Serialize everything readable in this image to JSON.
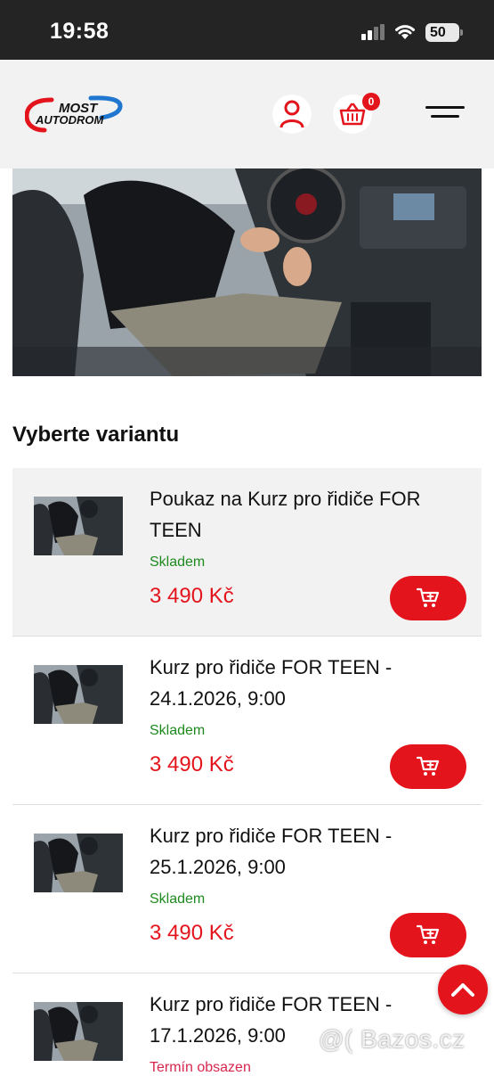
{
  "status_bar": {
    "time": "19:58",
    "battery": "50"
  },
  "header": {
    "logo_line1": "MOST",
    "logo_line2": "AUTODROM",
    "cart_count": "0"
  },
  "section_title": "Vyberte variantu",
  "variants": [
    {
      "title": "Poukaz na Kurz pro řidiče FOR TEEN",
      "stock": "Skladem",
      "price": "3 490 Kč"
    },
    {
      "title": "Kurz pro řidiče FOR TEEN - 24.1.2026, 9:00",
      "stock": "Skladem",
      "price": "3 490 Kč"
    },
    {
      "title": "Kurz pro řidiče FOR TEEN - 25.1.2026, 9:00",
      "stock": "Skladem",
      "price": "3 490 Kč"
    },
    {
      "title": "Kurz pro řidiče FOR TEEN - 17.1.2026, 9:00",
      "stock": "Termín obsazen",
      "price": ""
    }
  ],
  "watermark": "@( Bazos.cz",
  "colors": {
    "accent": "#e3141c",
    "in_stock": "#1e8a1e",
    "out_of_stock": "#d7264d",
    "logo_blue": "#1f77d0"
  },
  "icons": [
    "signal-icon",
    "wifi-icon",
    "battery-icon",
    "user-icon",
    "basket-icon",
    "menu-icon",
    "cart-icon",
    "chevron-up-icon"
  ]
}
